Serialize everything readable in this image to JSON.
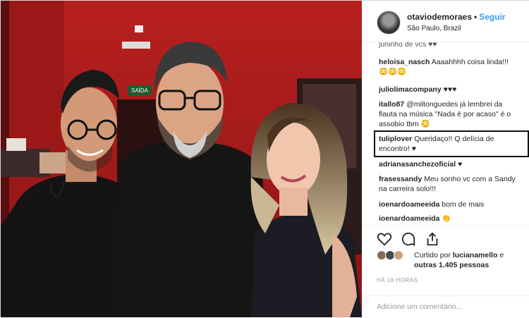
{
  "post": {
    "username": "otaviodemoraes",
    "follow_label": "Seguir",
    "location": "São Paulo, Brazil"
  },
  "photo": {
    "exit_sign": "SAÍDA"
  },
  "comments": [
    {
      "user": "juninho de vcs",
      "text": "♥♥"
    },
    {
      "user": "heloisa_nasch",
      "text": "Aaaahhhh coisa linda!!!",
      "text2": "😳😳😳"
    },
    {
      "user": "juliolimacompany",
      "text": "♥♥♥"
    },
    {
      "user": "itallo87",
      "text": "@miltonguedes já lembrei da flauta na música \"Nada é por acaso\" é o assobio tbm 😳"
    },
    {
      "user": "tuliplover",
      "text": "Queridaço!! Q delícia de encontro! ♥"
    },
    {
      "user": "adrianasanchezoficial",
      "text": "♥"
    },
    {
      "user": "frasessandy",
      "text": "Meu sonho vc com a Sandy na carreira solo!!!"
    },
    {
      "user": "ioenardoameeida",
      "text": "bom de mais"
    },
    {
      "user": "ioenardoameeida",
      "text": "👏"
    }
  ],
  "likes": {
    "prefix": "Curtido por",
    "first_user": "lucianamello",
    "suffix": "e",
    "others": "outras 1.405 pessoas"
  },
  "time": "HÁ 18 HORAS",
  "add_comment_placeholder": "Adicione um comentário..."
}
